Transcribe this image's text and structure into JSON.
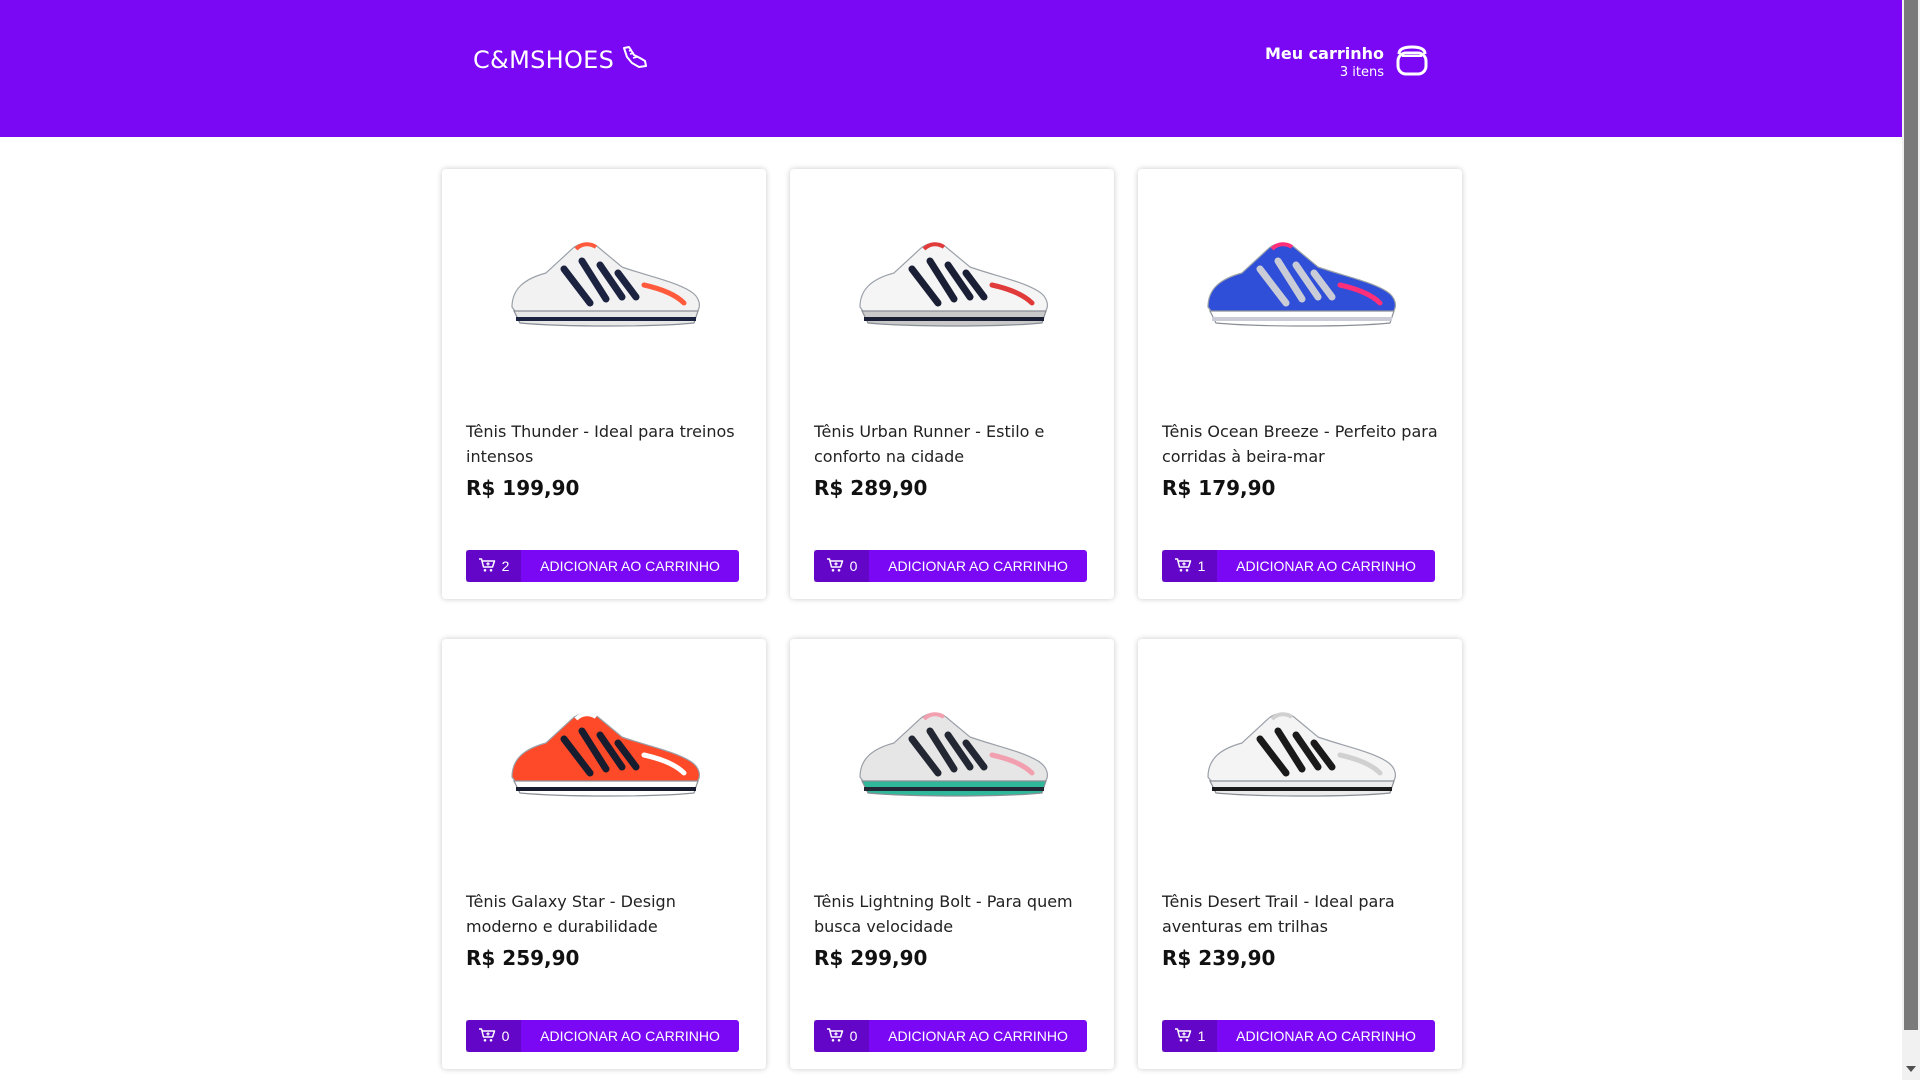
{
  "brand": {
    "name": "C&MSHOES"
  },
  "cart": {
    "title": "Meu carrinho",
    "count_label": "3 itens"
  },
  "products": [
    {
      "name": "Tênis Thunder - Ideal para treinos intensos",
      "price": "R$ 199,90",
      "in_cart": "2",
      "button_label": "ADICIONAR AO CARRINHO",
      "colors": {
        "upper": "#f2f2f2",
        "accent": "#1b2340",
        "sole": "#e8e8e8",
        "pop": "#ff5a3c"
      }
    },
    {
      "name": "Tênis Urban Runner - Estilo e conforto na cidade",
      "price": "R$ 289,90",
      "in_cart": "0",
      "button_label": "ADICIONAR AO CARRINHO",
      "colors": {
        "upper": "#f5f5f5",
        "accent": "#1a1f36",
        "sole": "#c9c9c9",
        "pop": "#e03a3a"
      }
    },
    {
      "name": "Tênis Ocean Breeze - Perfeito para corridas à beira-mar",
      "price": "R$ 179,90",
      "in_cart": "1",
      "button_label": "ADICIONAR AO CARRINHO",
      "colors": {
        "upper": "#2f4fd8",
        "accent": "#c9ccd6",
        "sole": "#ffffff",
        "pop": "#ff2f7a"
      }
    },
    {
      "name": "Tênis Galaxy Star - Design moderno e durabilidade",
      "price": "R$ 259,90",
      "in_cart": "0",
      "button_label": "ADICIONAR AO CARRINHO",
      "colors": {
        "upper": "#ff4a2a",
        "accent": "#171d2e",
        "sole": "#ffffff",
        "pop": "#ffffff"
      }
    },
    {
      "name": "Tênis Lightning Bolt - Para quem busca velocidade",
      "price": "R$ 299,90",
      "in_cart": "0",
      "button_label": "ADICIONAR AO CARRINHO",
      "colors": {
        "upper": "#e6e6e6",
        "accent": "#222733",
        "sole": "#2fb89a",
        "pop": "#f2a0b0"
      }
    },
    {
      "name": "Tênis Desert Trail - Ideal para aventuras em trilhas",
      "price": "R$ 239,90",
      "in_cart": "1",
      "button_label": "ADICIONAR AO CARRINHO",
      "colors": {
        "upper": "#f4f4f4",
        "accent": "#1a1a1a",
        "sole": "#ececec",
        "pop": "#d0d0d0"
      }
    }
  ]
}
